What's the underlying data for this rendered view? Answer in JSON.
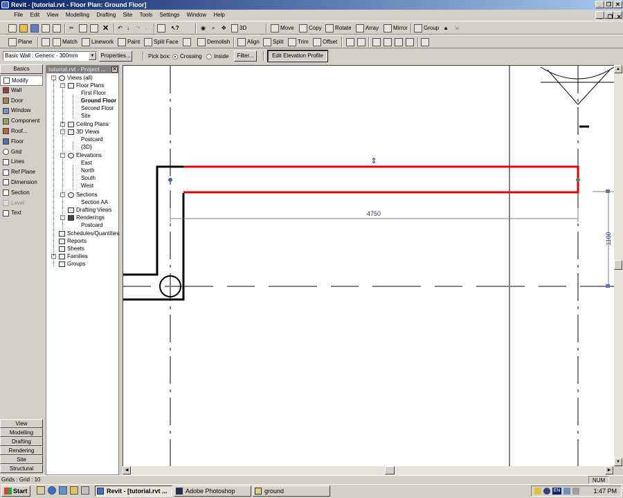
{
  "window": {
    "title": "Revit - [tutorial.rvt - Floor Plan: Ground Floor]"
  },
  "menu": [
    "File",
    "Edit",
    "View",
    "Modelling",
    "Drafting",
    "Site",
    "Tools",
    "Settings",
    "Window",
    "Help"
  ],
  "toolbar1": {
    "3d": "3D",
    "move": "Move",
    "copy": "Copy",
    "rotate": "Rotate",
    "array": "Array",
    "mirror": "Mirror",
    "group": "Group"
  },
  "toolbar2": {
    "plane": "Plane",
    "match": "Match",
    "linework": "Linework",
    "paint": "Paint",
    "split_face": "Split Face",
    "demolish": "Demolish",
    "align": "Align",
    "split": "Split",
    "trim": "Trim",
    "offset": "Offset"
  },
  "options_bar": {
    "type_selector": "Basic Wall : Generic - 300mm",
    "properties": "Properties...",
    "pick_box": "Pick box:",
    "crossing": "Crossing",
    "inside": "Inside",
    "filter": "Filter...",
    "edit_elevation_profile": "Edit Elevation Profile"
  },
  "design_bar": {
    "basics_tab": "Basics",
    "items": [
      {
        "label": "Modify",
        "icon": "arrow-cursor-icon"
      },
      {
        "label": "Wall",
        "icon": "wall-icon"
      },
      {
        "label": "Door",
        "icon": "door-icon"
      },
      {
        "label": "Window",
        "icon": "window-icon"
      },
      {
        "label": "Component",
        "icon": "component-icon"
      },
      {
        "label": "Roof...",
        "icon": "roof-icon"
      },
      {
        "label": "Floor",
        "icon": "floor-icon"
      },
      {
        "label": "Grid",
        "icon": "grid-icon"
      },
      {
        "label": "Lines",
        "icon": "lines-icon"
      },
      {
        "label": "Ref Plane",
        "icon": "ref-plane-icon"
      },
      {
        "label": "Dimension",
        "icon": "dimension-icon"
      },
      {
        "label": "Section",
        "icon": "section-icon"
      },
      {
        "label": "Level",
        "icon": "level-icon"
      },
      {
        "label": "Text",
        "icon": "text-icon"
      }
    ],
    "bottom_tabs": [
      "View",
      "Modelling",
      "Drafting",
      "Rendering",
      "Site",
      "Structural"
    ]
  },
  "project_browser": {
    "title": "tutorial.rvt - Project ...",
    "tree": {
      "views_all": "Views (all)",
      "floor_plans": "Floor Plans",
      "first_floor": "First Floor",
      "ground_floor": "Ground Floor",
      "second_floor": "Second Floor",
      "site": "Site",
      "ceiling_plans": "Ceiling Plans",
      "views_3d": "3D Views",
      "postcard": "Postcard",
      "view_3d": "{3D}",
      "elevations": "Elevations",
      "east": "East",
      "north": "North",
      "south": "South",
      "west": "West",
      "sections": "Sections",
      "section_aa": "Section AA",
      "drafting_views": "Drafting Views",
      "renderings": "Renderings",
      "rendering_postcard": "Postcard",
      "schedules": "Schedules/Quantities",
      "reports": "Reports",
      "sheets": "Sheets",
      "families": "Families",
      "groups": "Groups"
    }
  },
  "drawing": {
    "dim_horizontal": "4750",
    "dim_vertical": "1100",
    "flip_symbol": "⇕"
  },
  "status": {
    "text": "Grids : Grid : 10",
    "num": "NUM"
  },
  "taskbar": {
    "start": "Start",
    "tasks": [
      "Revit - [tutorial.rvt ...",
      "Adobe Photoshop",
      "ground"
    ],
    "lang": "EN",
    "clock": "1:47 PM"
  }
}
